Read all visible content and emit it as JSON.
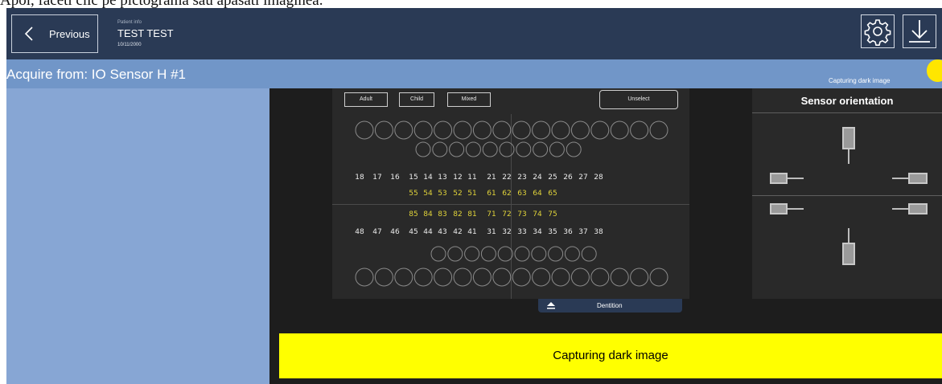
{
  "caption": "Apoi, faceti clic pe pictograma sau apasati imaginea.",
  "topbar": {
    "previous_label": "Previous",
    "patient_caption": "Patient info",
    "patient_name": "TEST TEST",
    "patient_date": "10/11/2000",
    "settings_icon": "gear-icon",
    "download_icon": "download-arrow-icon"
  },
  "acquire": {
    "title": "Acquire from: IO Sensor H #1",
    "status_label": "Capturing dark image",
    "status_color": "#ffe600"
  },
  "dentition": {
    "buttons": [
      "Adult",
      "Child",
      "Mixed"
    ],
    "unselect_label": "Unselect",
    "upper_permanent": [
      "18",
      "17",
      "16",
      "15",
      "14",
      "13",
      "12",
      "11",
      "21",
      "22",
      "23",
      "24",
      "25",
      "26",
      "27",
      "28"
    ],
    "upper_primary": [
      "55",
      "54",
      "53",
      "52",
      "51",
      "61",
      "62",
      "63",
      "64",
      "65"
    ],
    "lower_primary": [
      "85",
      "84",
      "83",
      "82",
      "81",
      "71",
      "72",
      "73",
      "74",
      "75"
    ],
    "lower_permanent": [
      "48",
      "47",
      "46",
      "45",
      "44",
      "43",
      "42",
      "41",
      "31",
      "32",
      "33",
      "34",
      "35",
      "36",
      "37",
      "38"
    ],
    "tab_label": "Dentition",
    "primary_color": "#e0d33a"
  },
  "sensor": {
    "title": "Sensor orientation",
    "options": [
      "wire-down",
      "wire-right",
      "wire-left",
      "wire-right",
      "wire-left",
      "wire-up"
    ]
  },
  "banner": {
    "text": "Capturing dark image",
    "color": "#ffff00"
  }
}
